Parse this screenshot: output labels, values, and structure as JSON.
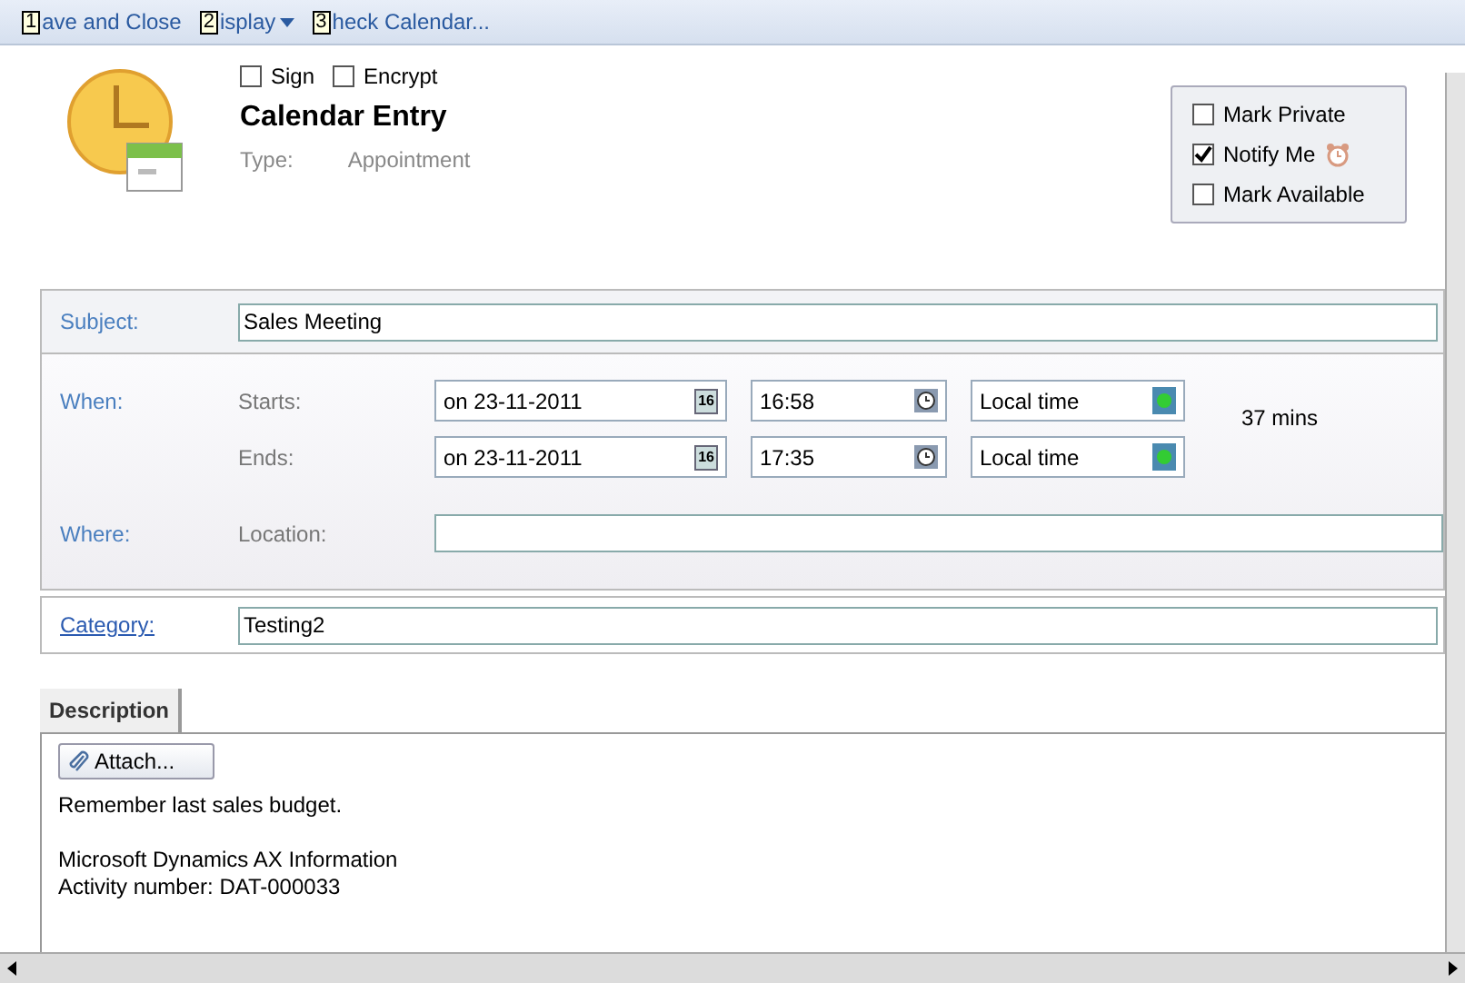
{
  "toolbar": [
    {
      "key": "1",
      "label": "ave and Close",
      "dropdown": false
    },
    {
      "key": "2",
      "label": "isplay",
      "dropdown": true
    },
    {
      "key": "3",
      "label": "heck Calendar...",
      "dropdown": false
    }
  ],
  "header": {
    "options": [
      {
        "label": "Sign",
        "checked": false
      },
      {
        "label": "Encrypt",
        "checked": false
      }
    ],
    "title": "Calendar Entry",
    "type_label": "Type:",
    "type_value": "Appointment"
  },
  "flags": [
    {
      "label": "Mark Private",
      "checked": false,
      "alarm": false
    },
    {
      "label": "Notify Me",
      "checked": true,
      "alarm": true
    },
    {
      "label": "Mark Available",
      "checked": false,
      "alarm": false
    }
  ],
  "subject": {
    "label": "Subject:",
    "value": "Sales Meeting"
  },
  "when": {
    "label": "When:",
    "rows": [
      {
        "label": "Starts:",
        "date": "on 23-11-2011",
        "date_icon": "16",
        "time": "16:58",
        "zone": "Local time"
      },
      {
        "label": "Ends:",
        "date": "on 23-11-2011",
        "date_icon": "16",
        "time": "17:35",
        "zone": "Local time"
      }
    ],
    "duration": "37 mins"
  },
  "where": {
    "label": "Where:",
    "field_label": "Location:"
  },
  "category": {
    "label": "Category:",
    "value": "Testing2"
  },
  "tabs": [
    {
      "label": "Description",
      "selected": true
    }
  ],
  "attach_button": "Attach...",
  "description": [
    [
      "Remember last sales budget."
    ],
    [
      "Microsoft Dynamics AX Information",
      "Activity number: DAT-000033"
    ]
  ]
}
